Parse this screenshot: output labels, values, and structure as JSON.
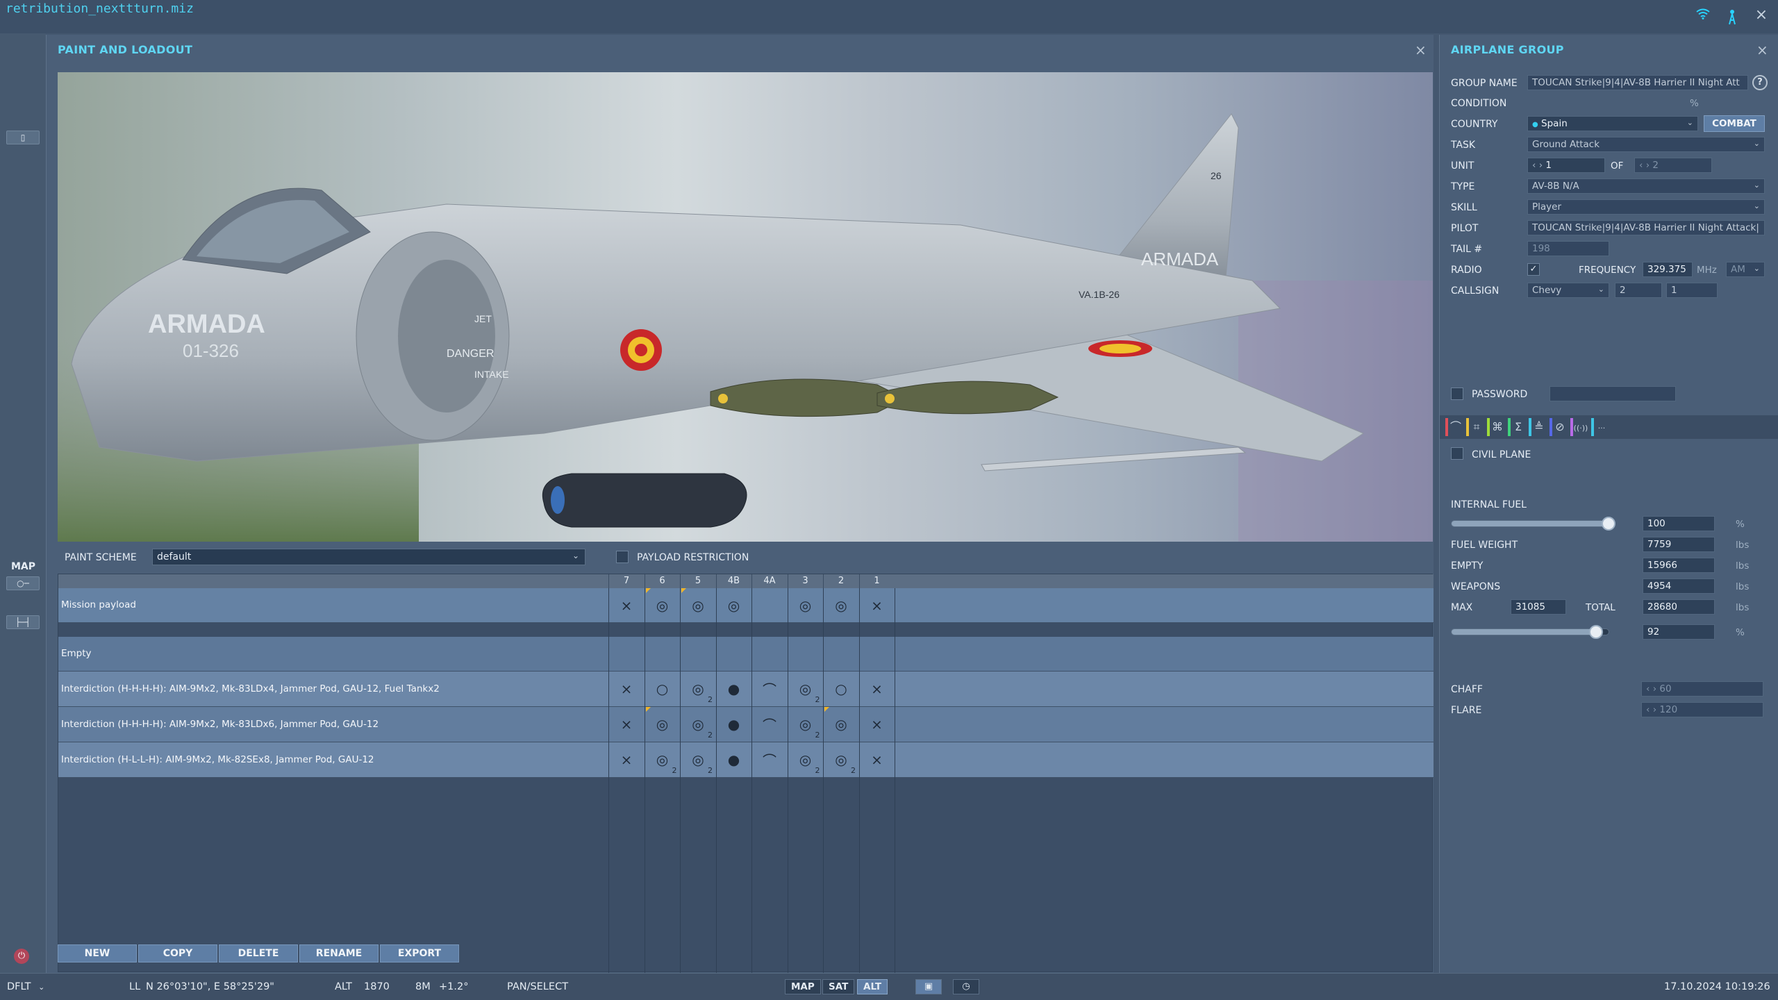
{
  "window": {
    "mission_file": "retribution_nexttturn.miz",
    "close_icon": "×"
  },
  "left_toolbar": {
    "map_label": "MAP"
  },
  "paint_panel": {
    "title": "PAINT AND LOADOUT",
    "paint_scheme_label": "PAINT SCHEME",
    "paint_scheme_value": "default",
    "payload_restriction_label": "PAYLOAD RESTRICTION",
    "stations": [
      "7",
      "6",
      "5",
      "4B",
      "4A",
      "3",
      "2",
      "1"
    ],
    "rows": [
      {
        "name": "Mission payload",
        "cells": [
          {
            "icon": "⨯",
            "count": "",
            "mark": false
          },
          {
            "icon": "◎",
            "count": "",
            "mark": true
          },
          {
            "icon": "◎",
            "count": "",
            "mark": true
          },
          {
            "icon": "◎",
            "count": "",
            "mark": false
          },
          {
            "icon": "",
            "count": "",
            "mark": false
          },
          {
            "icon": "◎",
            "count": "",
            "mark": false
          },
          {
            "icon": "◎",
            "count": "",
            "mark": false
          },
          {
            "icon": "⨯",
            "count": "",
            "mark": false
          }
        ]
      },
      {
        "name": "Empty",
        "cells": [
          {
            "icon": "",
            "count": "",
            "mark": false
          },
          {
            "icon": "",
            "count": "",
            "mark": false
          },
          {
            "icon": "",
            "count": "",
            "mark": false
          },
          {
            "icon": "",
            "count": "",
            "mark": false
          },
          {
            "icon": "",
            "count": "",
            "mark": false
          },
          {
            "icon": "",
            "count": "",
            "mark": false
          },
          {
            "icon": "",
            "count": "",
            "mark": false
          },
          {
            "icon": "",
            "count": "",
            "mark": false
          }
        ]
      },
      {
        "name": "Interdiction (H-H-H-H): AIM-9Mx2, Mk-83LDx4, Jammer Pod, GAU-12, Fuel Tankx2",
        "cells": [
          {
            "icon": "⨯",
            "count": "",
            "mark": false
          },
          {
            "icon": "○",
            "count": "",
            "mark": false
          },
          {
            "icon": "◎",
            "count": "2",
            "mark": false
          },
          {
            "icon": "●",
            "count": "",
            "mark": false
          },
          {
            "icon": "⌒",
            "count": "",
            "mark": false
          },
          {
            "icon": "◎",
            "count": "2",
            "mark": false
          },
          {
            "icon": "○",
            "count": "",
            "mark": false
          },
          {
            "icon": "⨯",
            "count": "",
            "mark": false
          }
        ]
      },
      {
        "name": "Interdiction (H-H-H-H): AIM-9Mx2, Mk-83LDx6, Jammer Pod, GAU-12",
        "cells": [
          {
            "icon": "⨯",
            "count": "",
            "mark": false
          },
          {
            "icon": "◎",
            "count": "",
            "mark": true
          },
          {
            "icon": "◎",
            "count": "2",
            "mark": false
          },
          {
            "icon": "●",
            "count": "",
            "mark": false
          },
          {
            "icon": "⌒",
            "count": "",
            "mark": false
          },
          {
            "icon": "◎",
            "count": "2",
            "mark": false
          },
          {
            "icon": "◎",
            "count": "",
            "mark": true
          },
          {
            "icon": "⨯",
            "count": "",
            "mark": false
          }
        ]
      },
      {
        "name": "Interdiction (H-L-L-H): AIM-9Mx2, Mk-82SEx8, Jammer Pod, GAU-12",
        "cells": [
          {
            "icon": "⨯",
            "count": "",
            "mark": false
          },
          {
            "icon": "◎",
            "count": "2",
            "mark": false
          },
          {
            "icon": "◎",
            "count": "2",
            "mark": false
          },
          {
            "icon": "●",
            "count": "",
            "mark": false
          },
          {
            "icon": "⌒",
            "count": "",
            "mark": false
          },
          {
            "icon": "◎",
            "count": "2",
            "mark": false
          },
          {
            "icon": "◎",
            "count": "2",
            "mark": false
          },
          {
            "icon": "⨯",
            "count": "",
            "mark": false
          }
        ]
      }
    ],
    "actions": {
      "new": "NEW",
      "copy": "COPY",
      "delete": "DELETE",
      "rename": "RENAME",
      "export": "EXPORT"
    },
    "aircraft_markings": {
      "fuselage": "ARMADA",
      "serial": "01-326",
      "tail": "ARMADA",
      "tail_code": "VA.1B-26",
      "tail_number": "26",
      "intake_text": "DANGER",
      "jet_text": "JET",
      "intake_label": "INTAKE"
    }
  },
  "group_panel": {
    "title": "AIRPLANE GROUP",
    "group_name_label": "GROUP NAME",
    "group_name_value": "TOUCAN Strike|9|4|AV-8B Harrier II Night Att",
    "help_icon": "?",
    "condition_label": "CONDITION",
    "condition_unit": "%",
    "country_label": "COUNTRY",
    "country_value": "Spain",
    "combat_label": "COMBAT",
    "task_label": "TASK",
    "task_value": "Ground Attack",
    "unit_label": "UNIT",
    "unit_value": "1",
    "of_label": "OF",
    "of_value": "2",
    "type_label": "TYPE",
    "type_value": "AV-8B N/A",
    "skill_label": "SKILL",
    "skill_value": "Player",
    "pilot_label": "PILOT",
    "pilot_value": "TOUCAN Strike|9|4|AV-8B Harrier II Night Attack|",
    "tail_label": "TAIL #",
    "tail_value": "198",
    "radio_label": "RADIO",
    "frequency_label": "FREQUENCY",
    "frequency_value": "329.375",
    "frequency_unit": "MHz",
    "modulation_value": "AM",
    "callsign_label": "CALLSIGN",
    "callsign_value": "Chevy",
    "callsign_num1": "2",
    "callsign_num2": "1",
    "password_label": "PASSWORD",
    "civil_plane_label": "CIVIL PLANE",
    "internal_fuel_label": "INTERNAL FUEL",
    "internal_fuel_value": "100",
    "internal_fuel_fraction": 1.0,
    "fuel_weight_label": "FUEL WEIGHT",
    "fuel_weight_value": "7759",
    "empty_label": "EMPTY",
    "empty_value": "15966",
    "weapons_label": "WEAPONS",
    "weapons_value": "4954",
    "max_label": "MAX",
    "max_value": "31085",
    "total_label": "TOTAL",
    "total_value": "28680",
    "total_percent_value": "92",
    "total_percent_fraction": 0.92,
    "weight_unit": "lbs",
    "percent_unit": "%",
    "chaff_label": "CHAFF",
    "chaff_value": "60",
    "flare_label": "FLARE",
    "flare_value": "120",
    "tool_colors": [
      "#e0505a",
      "#e8c23b",
      "#9fdc3a",
      "#3fd27c",
      "#3ec6e6",
      "#5668e8",
      "#b86be8",
      "#3ec6e6"
    ]
  },
  "status_bar": {
    "mode": "DFLT",
    "coord_prefix": "LL",
    "coordinates": "N 26°03'10\", E 58°25'29\"",
    "alt_label": "ALT",
    "alt_value": "1870",
    "magvar": "8M",
    "magvar_value": "+1.2°",
    "pan_select": "PAN/SELECT",
    "map_btn": "MAP",
    "sat_btn": "SAT",
    "alt_btn": "ALT",
    "datetime": "17.10.2024 10:19:26"
  }
}
